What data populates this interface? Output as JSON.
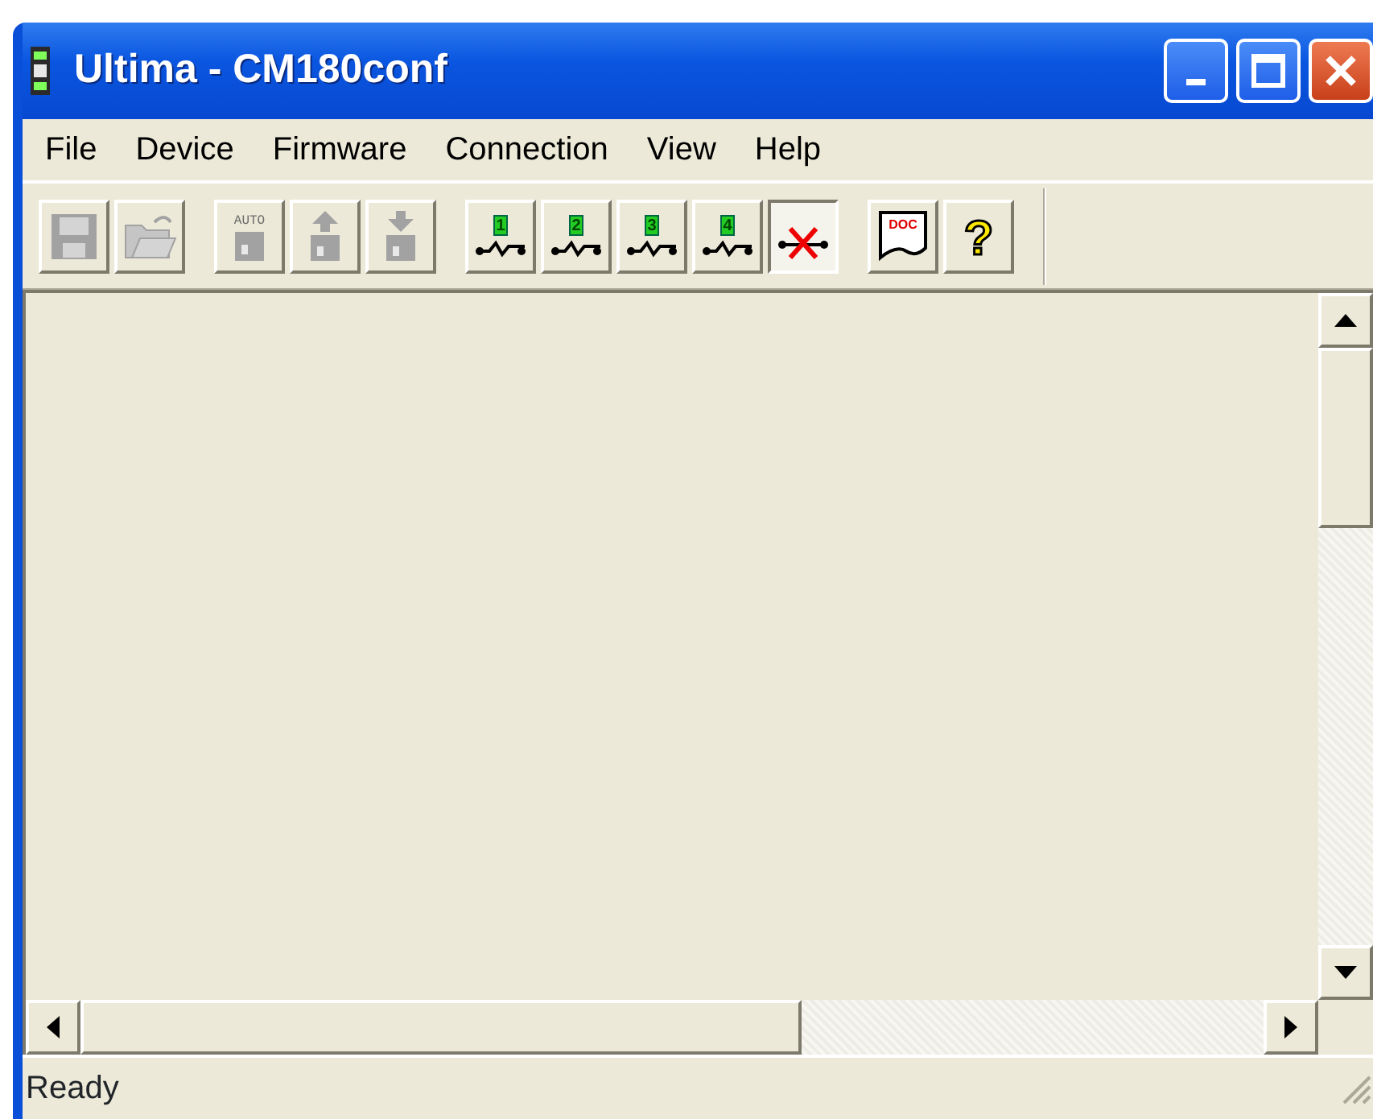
{
  "window": {
    "title": "Ultima - CM180conf"
  },
  "menu": [
    "File",
    "Device",
    "Firmware",
    "Connection",
    "View",
    "Help"
  ],
  "toolbar": [
    [
      {
        "kind": "save",
        "disabled": true,
        "pressed": false
      },
      {
        "kind": "open",
        "disabled": true,
        "pressed": false
      }
    ],
    [
      {
        "kind": "auto",
        "label": "AUTO",
        "disabled": true,
        "pressed": false
      },
      {
        "kind": "upload",
        "disabled": true,
        "pressed": false
      },
      {
        "kind": "download",
        "disabled": true,
        "pressed": false
      }
    ],
    [
      {
        "kind": "connect",
        "label": "1",
        "disabled": false,
        "pressed": false
      },
      {
        "kind": "connect",
        "label": "2",
        "disabled": false,
        "pressed": false
      },
      {
        "kind": "connect",
        "label": "3",
        "disabled": false,
        "pressed": false
      },
      {
        "kind": "connect",
        "label": "4",
        "disabled": false,
        "pressed": false
      },
      {
        "kind": "disconnect",
        "disabled": false,
        "pressed": true
      }
    ],
    [
      {
        "kind": "doc",
        "label": "DOC",
        "disabled": false,
        "pressed": false
      },
      {
        "kind": "help",
        "label": "?",
        "disabled": false,
        "pressed": false
      }
    ]
  ],
  "status_bar": "Ready"
}
